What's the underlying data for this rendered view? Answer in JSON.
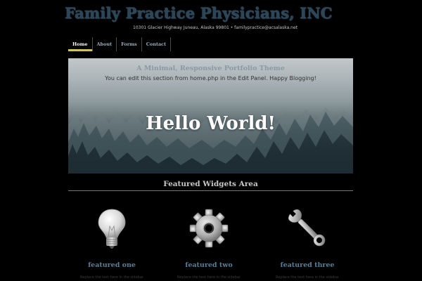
{
  "header": {
    "title": "Family Practice Physicians, INC",
    "address": "10301 Glacier Highway Juneau, Alaska 99801 • familypractice@acsalaska.net"
  },
  "nav": {
    "items": [
      {
        "label": "Home",
        "active": true
      },
      {
        "label": "About",
        "active": false
      },
      {
        "label": "Forms",
        "active": false
      },
      {
        "label": "Contact",
        "active": false
      }
    ]
  },
  "hero": {
    "tagline": "A Minimal, Responsive Portfolio Theme",
    "text": "You can edit this section from home.php in the Edit Panel. Happy Blogging!",
    "heading": "Hello World!"
  },
  "featured": {
    "title": "Featured Widgets Area",
    "widgets": [
      {
        "icon": "lightbulb-icon",
        "title": "featured one",
        "text": "Replace the text here in the sidebar"
      },
      {
        "icon": "gear-icon",
        "title": "featured two",
        "text": "Replace the text here in the sidebar"
      },
      {
        "icon": "wrench-icon",
        "title": "featured three",
        "text": "Replace the text here in the sidebar"
      }
    ]
  },
  "colors": {
    "background": "#000000",
    "nav_active_underline": "#d5c25a",
    "widget_title": "#5b7f98",
    "site_title": "#2b4658"
  }
}
